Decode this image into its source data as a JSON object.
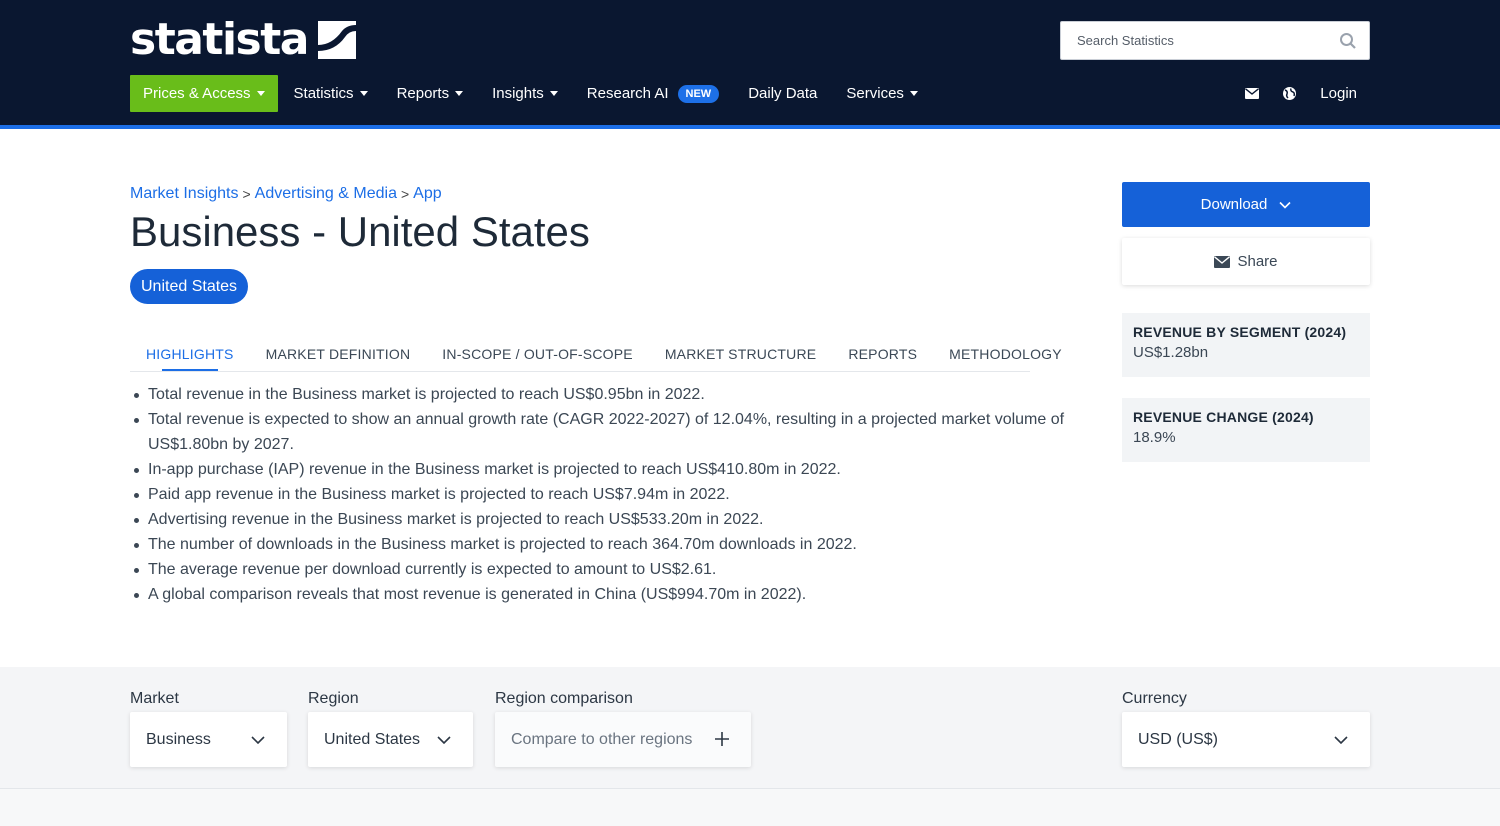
{
  "brand": {
    "logo_text": "statista"
  },
  "search": {
    "placeholder": "Search Statistics"
  },
  "nav": {
    "items": [
      {
        "label": "Prices & Access",
        "dropdown": true,
        "active": true
      },
      {
        "label": "Statistics",
        "dropdown": true
      },
      {
        "label": "Reports",
        "dropdown": true
      },
      {
        "label": "Insights",
        "dropdown": true
      },
      {
        "label": "Research AI",
        "badge": "NEW"
      },
      {
        "label": "Daily Data"
      },
      {
        "label": "Services",
        "dropdown": true
      }
    ],
    "right": {
      "icons": [
        "mail-icon",
        "globe-icon"
      ],
      "login": "Login"
    }
  },
  "breadcrumb": [
    "Market Insights",
    "Advertising & Media",
    "App"
  ],
  "page": {
    "title": "Business - United States",
    "region_pill": "United States"
  },
  "tabs": [
    "HIGHLIGHTS",
    "MARKET DEFINITION",
    "IN-SCOPE / OUT-OF-SCOPE",
    "MARKET STRUCTURE",
    "REPORTS",
    "METHODOLOGY"
  ],
  "highlights": [
    "Total revenue in the Business market is projected to reach US$0.95bn in 2022.",
    "Total revenue is expected to show an annual growth rate (CAGR 2022-2027) of 12.04%, resulting in a projected market volume of US$1.80bn by 2027.",
    "In-app purchase (IAP) revenue in the Business market is projected to reach US$410.80m in 2022.",
    "Paid app revenue in the Business market is projected to reach US$7.94m in 2022.",
    "Advertising revenue in the Business market is projected to reach US$533.20m in 2022.",
    "The number of downloads in the Business market is projected to reach 364.70m downloads in 2022.",
    "The average revenue per download currently is expected to amount to US$2.61.",
    "A global comparison reveals that most revenue is generated in China (US$994.70m in 2022)."
  ],
  "sidebar": {
    "download": "Download",
    "share": "Share",
    "cards": [
      {
        "label": "REVENUE BY SEGMENT (2024)",
        "value": "US$1.28bn"
      },
      {
        "label": "REVENUE CHANGE (2024)",
        "value": "18.9%"
      }
    ]
  },
  "filters": {
    "market": {
      "label": "Market",
      "value": "Business"
    },
    "region": {
      "label": "Region",
      "value": "United States"
    },
    "comparison": {
      "label": "Region comparison",
      "value": "Compare to other regions"
    },
    "currency": {
      "label": "Currency",
      "value": "USD (US$)"
    }
  },
  "colors": {
    "header_bg": "#0a1730",
    "accent_blue": "#1561d8",
    "active_green": "#69bd1a"
  }
}
